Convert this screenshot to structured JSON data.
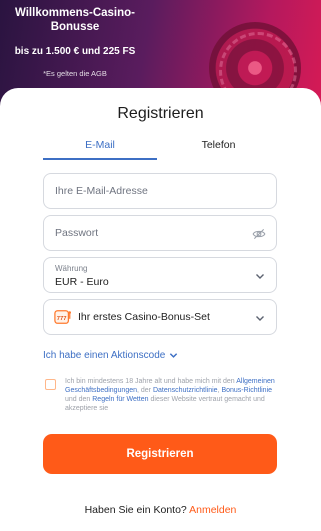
{
  "banner": {
    "title_line1": "Willkommens-Casino-",
    "title_line2": "Bonusse",
    "subtitle": "bis zu 1.500 € und 225 FS",
    "note": "*Es gelten die AGB"
  },
  "form": {
    "title": "Registrieren",
    "tabs": [
      {
        "label": "E-Mail",
        "active": true
      },
      {
        "label": "Telefon",
        "active": false
      }
    ],
    "email": {
      "placeholder": "Ihre E-Mail-Adresse",
      "value": ""
    },
    "password": {
      "placeholder": "Passwort",
      "value": "",
      "icon": "eye-off-icon"
    },
    "currency": {
      "label": "Währung",
      "value": "EUR - Euro",
      "icon": "chevron-down-icon"
    },
    "bonus": {
      "value": "Ihr erstes Casino-Bonus-Set",
      "icon": "slot-777-icon"
    },
    "promo_toggle": {
      "label": "Ich habe einen Aktionscode"
    },
    "consent": {
      "checked": false,
      "part1": "Ich bin mindestens 18 Jahre alt und habe mich mit den ",
      "link1": "Allgemeinen Geschäftsbedingungen",
      "part2": ", der ",
      "link2": "Datenschutzrichtlinie",
      "part3": ", ",
      "link3": "Bonus-Richtlinie",
      "part4": " und den ",
      "link4": "Regeln für Wetten",
      "part5": " dieser Website vertraut gemacht und akzeptiere sie"
    },
    "submit_label": "Registrieren",
    "login_prompt": "Haben Sie ein Konto?",
    "login_link": "Anmelden"
  },
  "colors": {
    "accent": "#ff5a18",
    "link": "#3d6fc4",
    "banner_start": "#2a1440",
    "banner_end": "#d61a55"
  }
}
